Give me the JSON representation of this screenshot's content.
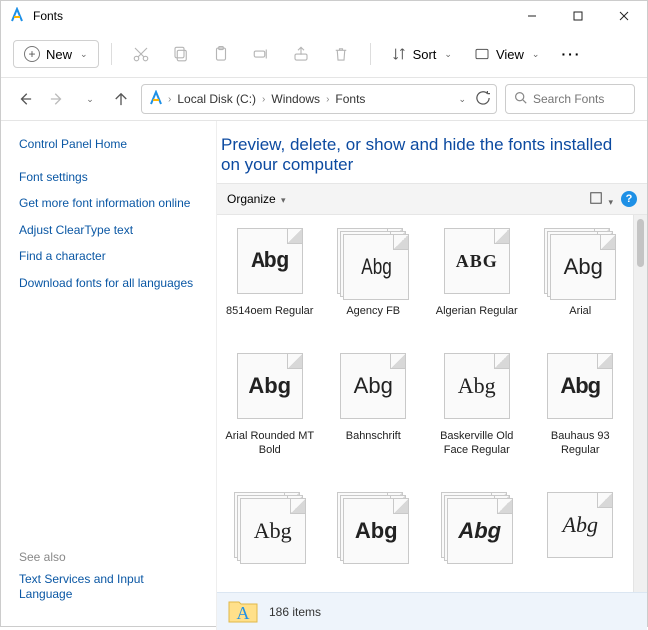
{
  "window": {
    "title": "Fonts"
  },
  "toolbar": {
    "new_label": "New",
    "sort_label": "Sort",
    "view_label": "View"
  },
  "breadcrumbs": {
    "a": "Local Disk (C:)",
    "b": "Windows",
    "c": "Fonts"
  },
  "search": {
    "placeholder": "Search Fonts"
  },
  "sidebar": {
    "cp_home": "Control Panel Home",
    "links": {
      "font_settings": "Font settings",
      "get_more": "Get more font information online",
      "cleartype": "Adjust ClearType text",
      "find_char": "Find a character",
      "download": "Download fonts for all languages"
    },
    "see_also_label": "See also",
    "see_also_link": "Text Services and Input Language"
  },
  "main": {
    "hero": "Preview, delete, or show and hide the fonts installed on your computer",
    "organize": "Organize"
  },
  "fonts": [
    {
      "name": "8514oem Regular",
      "sample": "Abg",
      "style": "font-family: monospace; font-weight: bold; letter-spacing:-1px;",
      "stack": false
    },
    {
      "name": "Agency FB",
      "sample": "Abg",
      "style": "font-family: 'Arial Narrow', sans-serif; transform: scaleX(0.78);",
      "stack": true
    },
    {
      "name": "Algerian Regular",
      "sample": "ABG",
      "style": "font-family: serif; font-weight: bold; font-variant: small-caps; letter-spacing:1px; font-size:18px;",
      "stack": false
    },
    {
      "name": "Arial",
      "sample": "Abg",
      "style": "font-family: Arial, sans-serif;",
      "stack": true
    },
    {
      "name": "Arial Rounded MT Bold",
      "sample": "Abg",
      "style": "font-family: Arial, sans-serif; font-weight: 900;",
      "stack": false
    },
    {
      "name": "Bahnschrift",
      "sample": "Abg",
      "style": "font-family: Arial, sans-serif; font-weight: 300;",
      "stack": false
    },
    {
      "name": "Baskerville Old Face Regular",
      "sample": "Abg",
      "style": "font-family: Georgia, serif;",
      "stack": false
    },
    {
      "name": "Bauhaus 93 Regular",
      "sample": "Abg",
      "style": "font-family: Arial, sans-serif; font-weight: 900; letter-spacing:-1px;",
      "stack": false
    },
    {
      "name": "",
      "sample": "Abg",
      "style": "font-family: Georgia, serif;",
      "stack": true
    },
    {
      "name": "",
      "sample": "Abg",
      "style": "font-family: Arial, sans-serif; font-weight: bold;",
      "stack": true
    },
    {
      "name": "",
      "sample": "Abg",
      "style": "font-family: Impact, sans-serif; font-style: italic; font-weight: bold;",
      "stack": true
    },
    {
      "name": "",
      "sample": "Abg",
      "style": "font-family: cursive; font-style: italic;",
      "stack": false
    }
  ],
  "status": {
    "count": "186 items"
  }
}
